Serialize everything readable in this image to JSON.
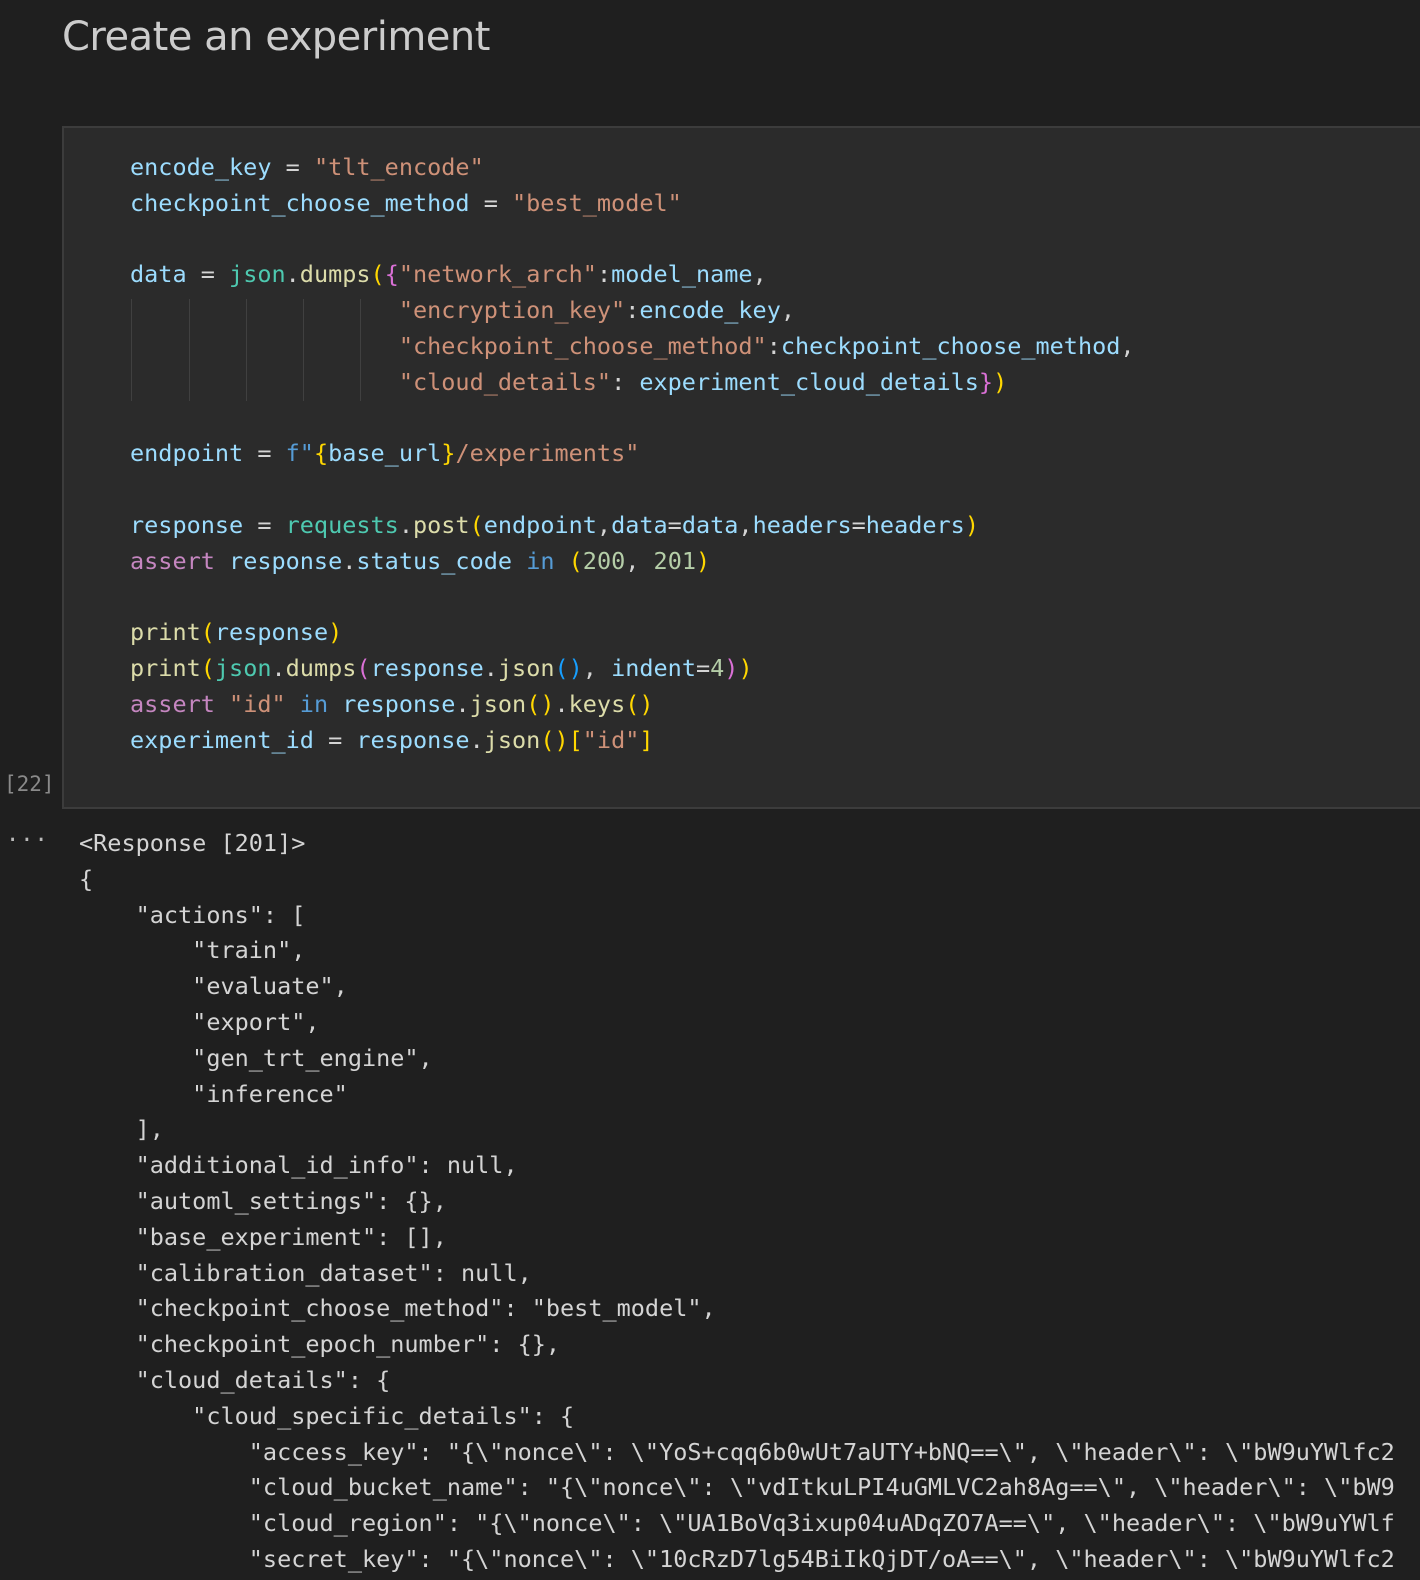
{
  "markdown": {
    "heading": "Create an experiment"
  },
  "cell": {
    "execution_count": "[22]",
    "output_marker": "···",
    "variables": {
      "encode_key": "encode_key",
      "checkpoint_choose_method": "checkpoint_choose_method",
      "data": "data",
      "endpoint": "endpoint",
      "response": "response",
      "experiment_id": "experiment_id",
      "model_name": "model_name",
      "experiment_cloud_details": "experiment_cloud_details",
      "base_url": "base_url",
      "headers": "headers",
      "indent": "indent",
      "status_code": "status_code"
    },
    "strings": {
      "encode_key_value": "\"tlt_encode\"",
      "checkpoint_method_value": "\"best_model\"",
      "key_network_arch": "\"network_arch\"",
      "key_encryption_key": "\"encryption_key\"",
      "key_checkpoint_choose_method": "\"checkpoint_choose_method\"",
      "key_cloud_details": "\"cloud_details\"",
      "fstring_prefix": "f\"",
      "fstring_suffix": "/experiments\"",
      "key_id": "\"id\""
    },
    "names": {
      "json": "json",
      "dumps": "dumps",
      "requests": "requests",
      "post": "post",
      "assert": "assert",
      "in": "in",
      "print": "print",
      "json_method": "json",
      "keys": "keys"
    },
    "numbers": {
      "status_ok": "200",
      "status_created": "201",
      "indent_value": "4"
    }
  },
  "output": {
    "lines": [
      "<Response [201]>",
      "{",
      "    \"actions\": [",
      "        \"train\",",
      "        \"evaluate\",",
      "        \"export\",",
      "        \"gen_trt_engine\",",
      "        \"inference\"",
      "    ],",
      "    \"additional_id_info\": null,",
      "    \"automl_settings\": {},",
      "    \"base_experiment\": [],",
      "    \"calibration_dataset\": null,",
      "    \"checkpoint_choose_method\": \"best_model\",",
      "    \"checkpoint_epoch_number\": {},",
      "    \"cloud_details\": {",
      "        \"cloud_specific_details\": {",
      "            \"access_key\": \"{\\\"nonce\\\": \\\"YoS+cqq6b0wUt7aUTY+bNQ==\\\", \\\"header\\\": \\\"bW9uYWlfc2",
      "            \"cloud_bucket_name\": \"{\\\"nonce\\\": \\\"vdItkuLPI4uGMLVC2ah8Ag==\\\", \\\"header\\\": \\\"bW9",
      "            \"cloud_region\": \"{\\\"nonce\\\": \\\"UA1BoVq3ixup04uADqZO7A==\\\", \\\"header\\\": \\\"bW9uYWlf",
      "            \"secret_key\": \"{\\\"nonce\\\": \\\"10cRzD7lg54BiIkQjDT/oA==\\\", \\\"header\\\": \\\"bW9uYWlfc2"
    ]
  }
}
